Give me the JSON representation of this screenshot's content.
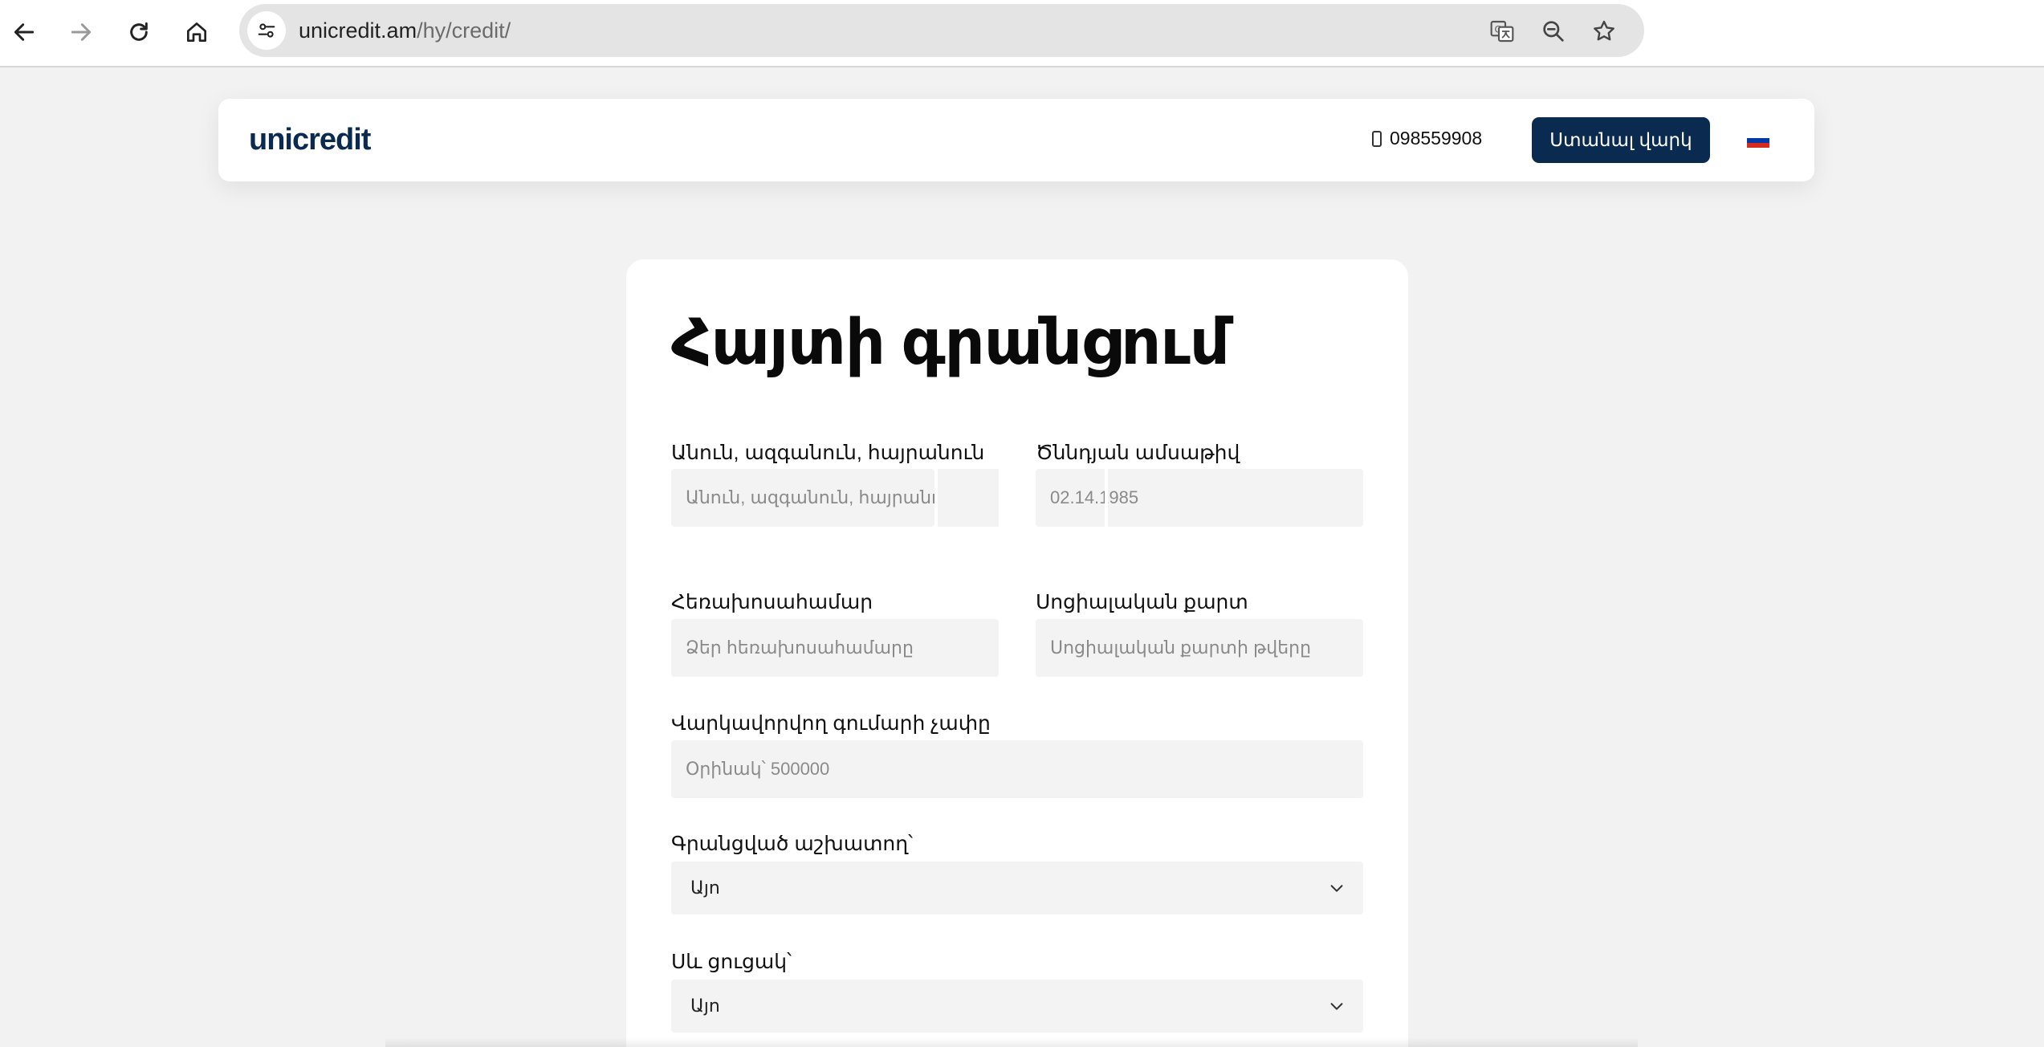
{
  "browser": {
    "url_host": "unicredit.am",
    "url_path": "/hy/credit/"
  },
  "site": {
    "logo": "unicredit",
    "phone": "098559908",
    "cta_label": "Ստանալ վարկ",
    "flag_colors": [
      "#ffffff",
      "#0039a6",
      "#d52b1e"
    ]
  },
  "form": {
    "title": "Հայտի գրանցում",
    "full_name": {
      "label": "Անուն, ազգանուն, հայրանուն",
      "placeholder": "Անուն, ազգանուն, հայրանուն"
    },
    "birth_date": {
      "label": "Ծննդյան ամսաթիվ",
      "placeholder": "02.14.1985"
    },
    "phone": {
      "label": "Հեռախոսահամար",
      "placeholder": "Ձեր հեռախոսահամարը"
    },
    "social_card": {
      "label": "Սոցիալական քարտ",
      "placeholder": "Սոցիալական քարտի թվերը"
    },
    "amount": {
      "label": "Վարկավորվող գումարի չափը",
      "placeholder": "Օրինակ՝ 500000"
    },
    "employed": {
      "label": "Գրանցված աշխատող՝",
      "value": "Այո"
    },
    "blacklist": {
      "label": "Սև ցուցակ՝",
      "value": "Այո"
    }
  },
  "colors": {
    "brand": "#0b2a4f",
    "field_bg": "#f3f3f3"
  }
}
